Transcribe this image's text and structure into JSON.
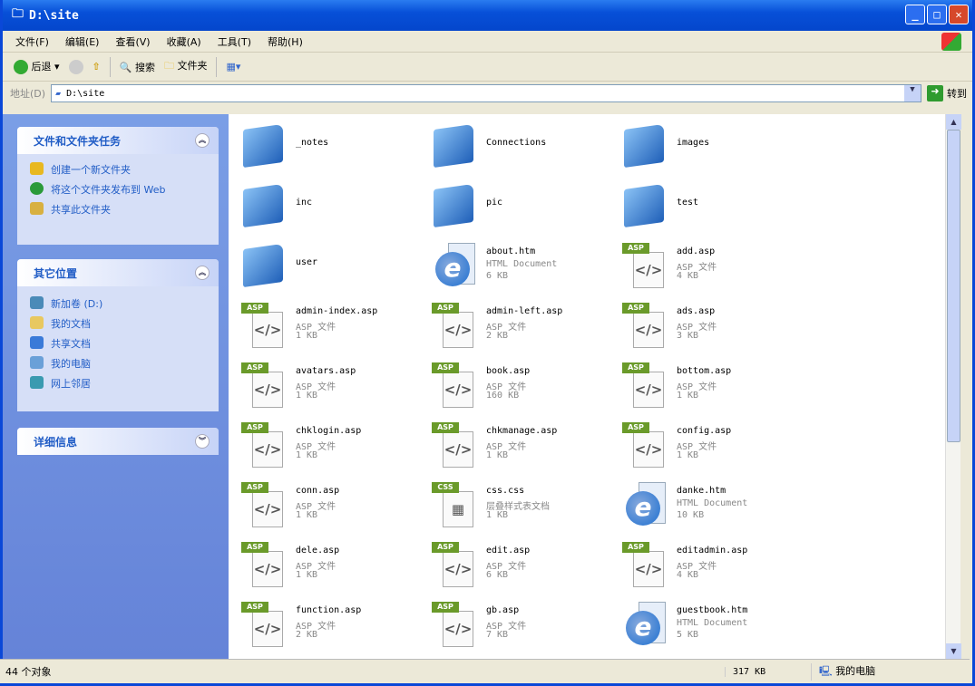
{
  "window": {
    "title": "D:\\site"
  },
  "menu": [
    "文件(F)",
    "编辑(E)",
    "查看(V)",
    "收藏(A)",
    "工具(T)",
    "帮助(H)"
  ],
  "toolbar": {
    "back": "后退",
    "search": "搜索",
    "folders": "文件夹"
  },
  "address": {
    "label": "地址(D)",
    "value": "D:\\site",
    "go": "转到"
  },
  "sidebar": {
    "tasks": {
      "title": "文件和文件夹任务",
      "items": [
        "创建一个新文件夹",
        "将这个文件夹发布到 Web",
        "共享此文件夹"
      ]
    },
    "places": {
      "title": "其它位置",
      "items": [
        "新加卷 (D:)",
        "我的文档",
        "共享文档",
        "我的电脑",
        "网上邻居"
      ]
    },
    "details": {
      "title": "详细信息"
    }
  },
  "files": [
    {
      "name": "_notes",
      "kind": "folder"
    },
    {
      "name": "Connections",
      "kind": "folder"
    },
    {
      "name": "images",
      "kind": "folder"
    },
    {
      "name": "inc",
      "kind": "folder"
    },
    {
      "name": "pic",
      "kind": "folder"
    },
    {
      "name": "test",
      "kind": "folder"
    },
    {
      "name": "user",
      "kind": "folder"
    },
    {
      "name": "about.htm",
      "kind": "htm",
      "type": "HTML Document",
      "size": "6 KB"
    },
    {
      "name": "add.asp",
      "kind": "asp",
      "type": "ASP 文件",
      "size": "4 KB"
    },
    {
      "name": "admin-index.asp",
      "kind": "asp",
      "type": "ASP 文件",
      "size": "1 KB"
    },
    {
      "name": "admin-left.asp",
      "kind": "asp",
      "type": "ASP 文件",
      "size": "2 KB"
    },
    {
      "name": "ads.asp",
      "kind": "asp",
      "type": "ASP 文件",
      "size": "3 KB"
    },
    {
      "name": "avatars.asp",
      "kind": "asp",
      "type": "ASP 文件",
      "size": "1 KB"
    },
    {
      "name": "book.asp",
      "kind": "asp",
      "type": "ASP 文件",
      "size": "160 KB"
    },
    {
      "name": "bottom.asp",
      "kind": "asp",
      "type": "ASP 文件",
      "size": "1 KB"
    },
    {
      "name": "chklogin.asp",
      "kind": "asp",
      "type": "ASP 文件",
      "size": "1 KB"
    },
    {
      "name": "chkmanage.asp",
      "kind": "asp",
      "type": "ASP 文件",
      "size": "1 KB"
    },
    {
      "name": "config.asp",
      "kind": "asp",
      "type": "ASP 文件",
      "size": "1 KB"
    },
    {
      "name": "conn.asp",
      "kind": "asp",
      "type": "ASP 文件",
      "size": "1 KB"
    },
    {
      "name": "css.css",
      "kind": "css",
      "type": "层叠样式表文档",
      "size": "1 KB"
    },
    {
      "name": "danke.htm",
      "kind": "htm",
      "type": "HTML Document",
      "size": "10 KB"
    },
    {
      "name": "dele.asp",
      "kind": "asp",
      "type": "ASP 文件",
      "size": "1 KB"
    },
    {
      "name": "edit.asp",
      "kind": "asp",
      "type": "ASP 文件",
      "size": "6 KB"
    },
    {
      "name": "editadmin.asp",
      "kind": "asp",
      "type": "ASP 文件",
      "size": "4 KB"
    },
    {
      "name": "function.asp",
      "kind": "asp",
      "type": "ASP 文件",
      "size": "2 KB"
    },
    {
      "name": "gb.asp",
      "kind": "asp",
      "type": "ASP 文件",
      "size": "7 KB"
    },
    {
      "name": "guestbook.htm",
      "kind": "htm",
      "type": "HTML Document",
      "size": "5 KB"
    }
  ],
  "badges": {
    "asp": "ASP",
    "css": "CSS"
  },
  "status": {
    "count": "44 个对象",
    "size": "317 KB",
    "location": "我的电脑"
  }
}
